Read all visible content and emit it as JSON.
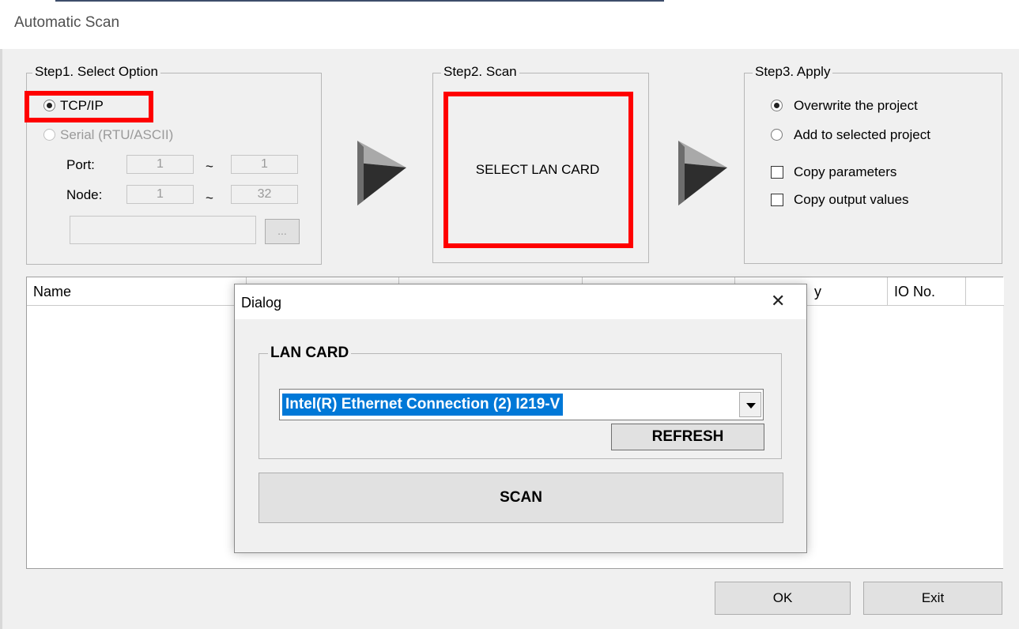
{
  "window": {
    "title": "Automatic Scan"
  },
  "step1": {
    "legend": "Step1. Select Option",
    "options": [
      {
        "label": "TCP/IP",
        "checked": true,
        "enabled": true
      },
      {
        "label": "Serial (RTU/ASCII)",
        "checked": false,
        "enabled": false
      }
    ],
    "port": {
      "label": "Port:",
      "from": "1",
      "to": "1"
    },
    "node": {
      "label": "Node:",
      "from": "1",
      "to": "32"
    },
    "range_separator": "~",
    "path_value": "",
    "browse_label": "..."
  },
  "step2": {
    "legend": "Step2. Scan",
    "button_label": "SELECT LAN CARD"
  },
  "step3": {
    "legend": "Step3. Apply",
    "options": [
      {
        "label": "Overwrite the project",
        "checked": true
      },
      {
        "label": "Add to selected project",
        "checked": false
      }
    ],
    "checkboxes": [
      {
        "label": "Copy parameters",
        "checked": false
      },
      {
        "label": "Copy output values",
        "checked": false
      }
    ]
  },
  "table": {
    "columns": [
      "Name",
      "",
      "",
      "",
      "y",
      "IO No.",
      ""
    ]
  },
  "footer": {
    "ok_label": "OK",
    "exit_label": "Exit"
  },
  "dialog": {
    "title": "Dialog",
    "close_glyph": "✕",
    "group_label": "LAN CARD",
    "selected_card": "Intel(R) Ethernet Connection (2) I219-V",
    "refresh_label": "REFRESH",
    "scan_label": "SCAN"
  },
  "colors": {
    "highlight": "#ff0000",
    "selection": "#0078d7"
  }
}
